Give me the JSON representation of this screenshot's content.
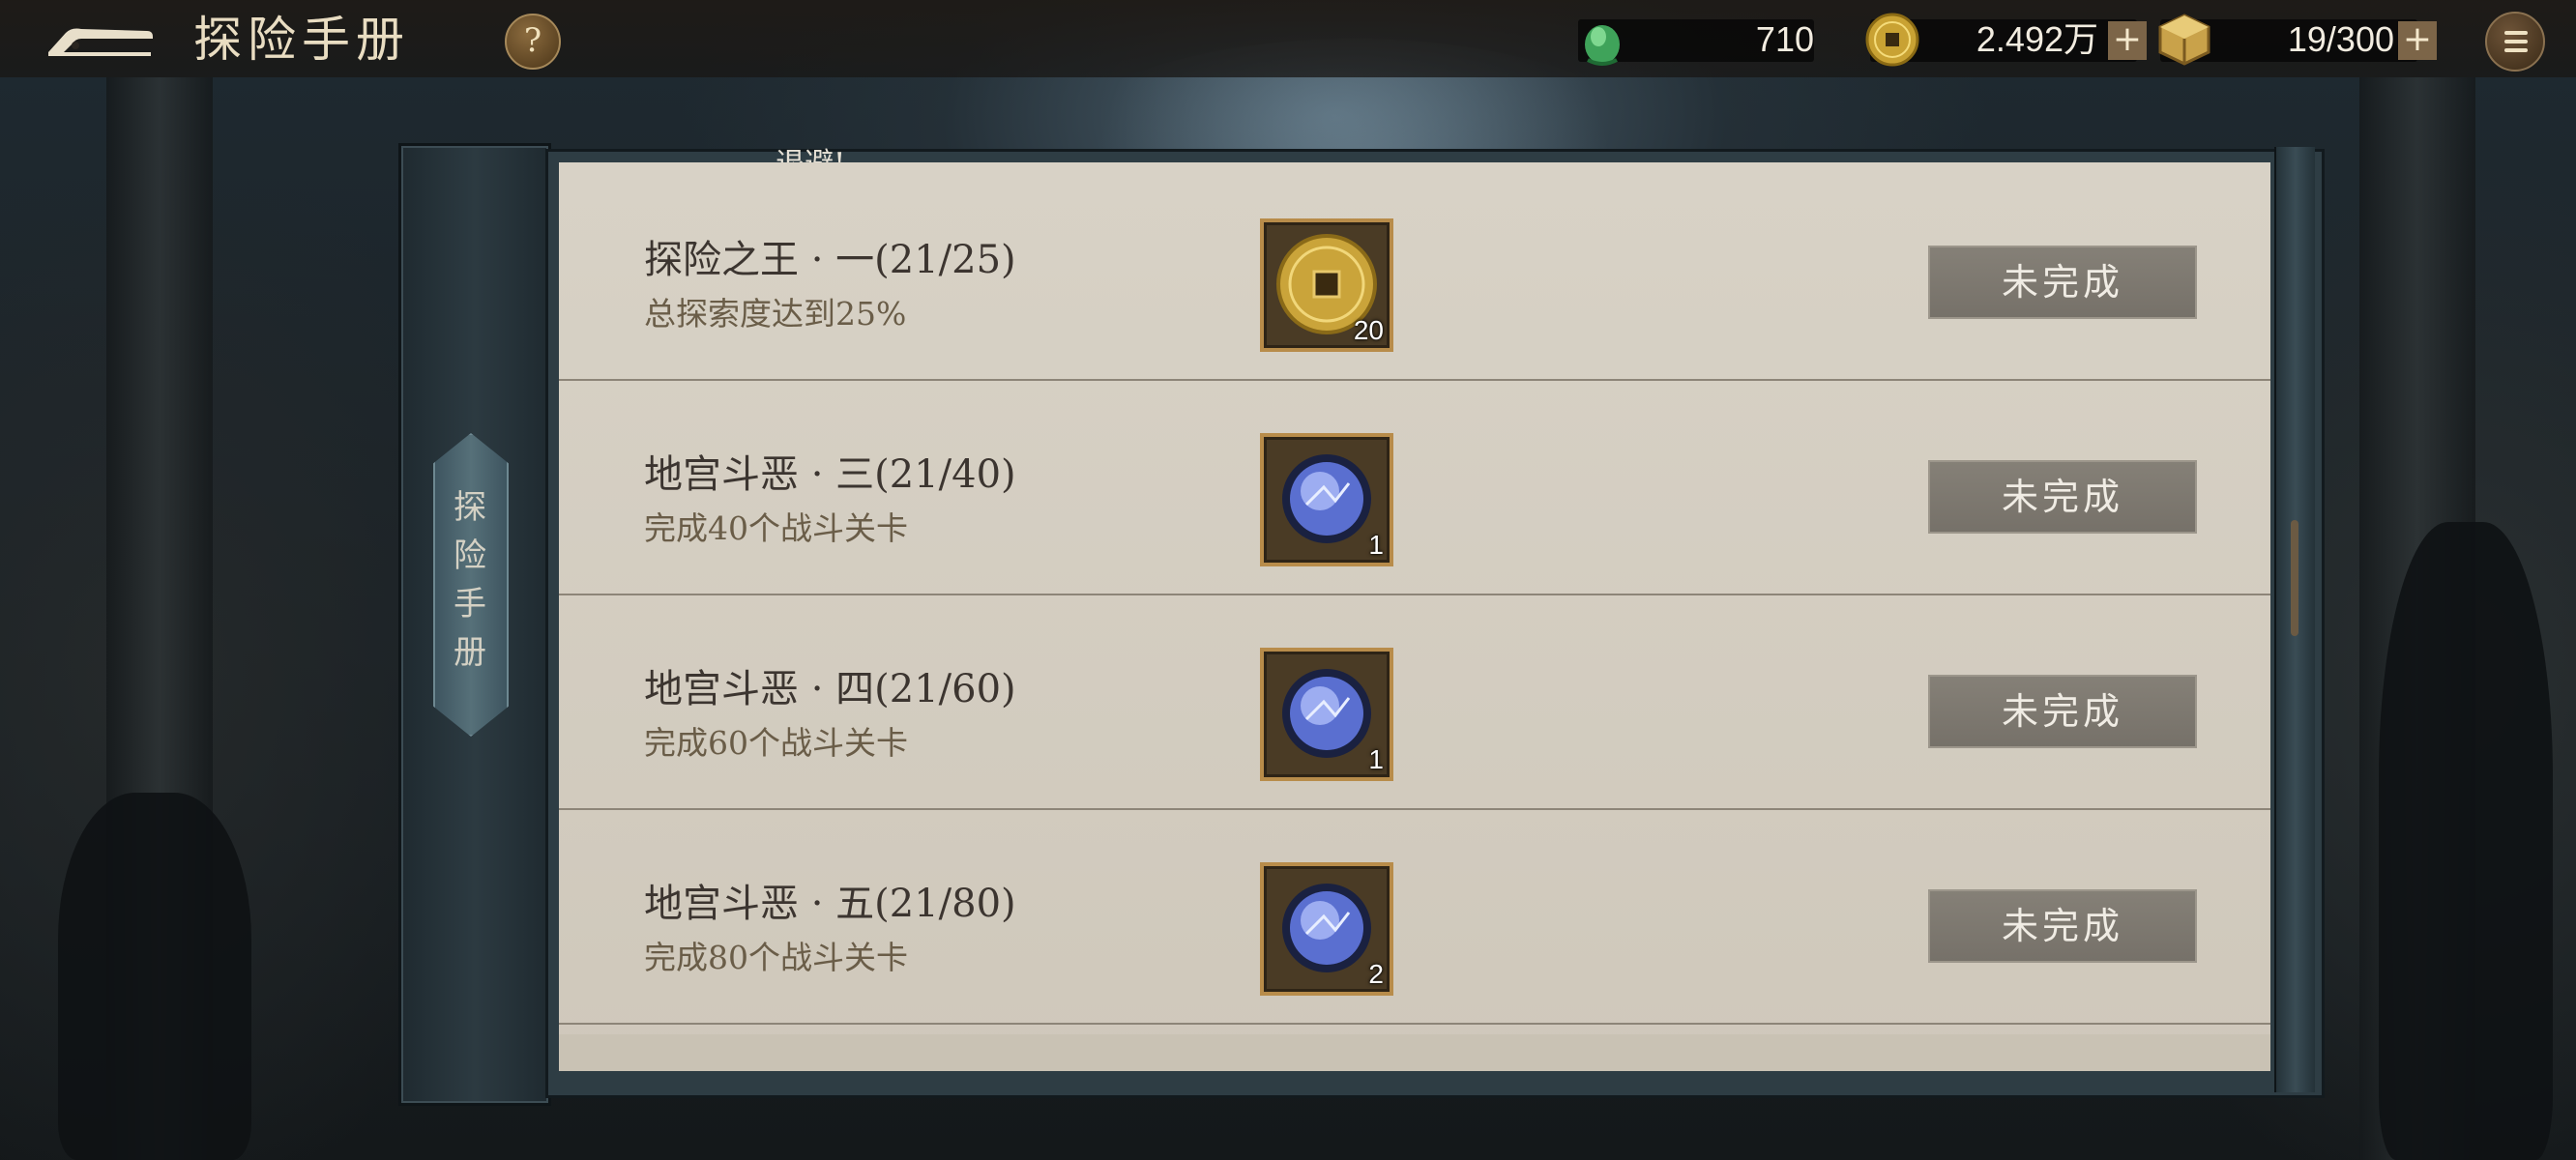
{
  "header": {
    "title": "探险手册",
    "help_label": "?"
  },
  "resources": {
    "jade": "710",
    "coins": "2.492万",
    "stamina": "19/300",
    "plus_label": "+"
  },
  "side": {
    "tab_label": "探险手册",
    "peek_text": "-退避!"
  },
  "quests": [
    {
      "title": "探险之王 · 一(21/25)",
      "desc": "总探索度达到25%",
      "reward_icon": "gold-coin-icon",
      "reward_count": "20",
      "status": "未完成"
    },
    {
      "title": "地宫斗恶 · 三(21/40)",
      "desc": "完成40个战斗关卡",
      "reward_icon": "blue-orb-icon",
      "reward_count": "1",
      "status": "未完成"
    },
    {
      "title": "地宫斗恶 · 四(21/60)",
      "desc": "完成60个战斗关卡",
      "reward_icon": "blue-orb-icon",
      "reward_count": "1",
      "status": "未完成"
    },
    {
      "title": "地宫斗恶 · 五(21/80)",
      "desc": "完成80个战斗关卡",
      "reward_icon": "blue-orb-icon",
      "reward_count": "2",
      "status": "未完成"
    }
  ],
  "colors": {
    "accent_gold": "#b88c4a",
    "status_button": "#7b766d",
    "panel_paper": "#d4cdc0"
  }
}
